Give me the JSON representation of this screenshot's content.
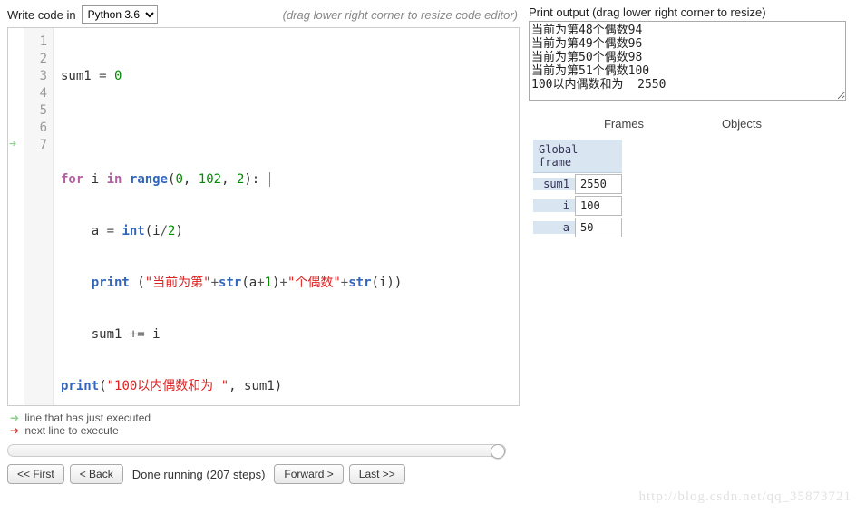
{
  "header": {
    "write_label": "Write code in",
    "language": "Python 3.6",
    "hint": "(drag lower right corner to resize code editor)"
  },
  "editor": {
    "lines": [
      "1",
      "2",
      "3",
      "4",
      "5",
      "6",
      "7"
    ],
    "exec_arrow_line": 7
  },
  "code_tokens": {
    "l1": {
      "a": "sum1 ",
      "b": "= ",
      "c": "0"
    },
    "l3": {
      "a": "for",
      "b": " i ",
      "c": "in",
      "d": " ",
      "e": "range",
      "f": "(",
      "g": "0",
      "h": ", ",
      "i": "102",
      "j": ", ",
      "k": "2",
      "l": "): "
    },
    "l4": {
      "a": "    a ",
      "b": "= ",
      "c": "int",
      "d": "(i",
      "e": "/",
      "f": "2",
      "g": ")"
    },
    "l5": {
      "a": "    ",
      "b": "print",
      "c": " (",
      "d": "\"当前为第\"",
      "e": "+",
      "f": "str",
      "g": "(a",
      "h": "+",
      "i": "1",
      "j": ")",
      "k": "+",
      "l": "\"个偶数\"",
      "m": "+",
      "n": "str",
      "o": "(i))"
    },
    "l6": {
      "a": "    sum1 ",
      "b": "+=",
      "c": " i"
    },
    "l7": {
      "a": "print",
      "b": "(",
      "c": "\"100以内偶数和为 \"",
      "d": ", sum1)"
    }
  },
  "legend": {
    "executed": "line that has just executed",
    "next": "next line to execute",
    "arrow_executed_color": "#8bd18b",
    "arrow_next_color": "#cc3b3b"
  },
  "controls": {
    "first": "<< First",
    "back": "< Back",
    "status": "Done running (207 steps)",
    "forward": "Forward >",
    "last": "Last >>"
  },
  "output": {
    "label": "Print output (drag lower right corner to resize)",
    "text": "当前为第48个偶数94\n当前为第49个偶数96\n当前为第50个偶数98\n当前为第51个偶数100\n100以内偶数和为  2550"
  },
  "viz": {
    "frames_label": "Frames",
    "objects_label": "Objects",
    "frame_title": "Global frame",
    "vars": [
      {
        "name": "sum1",
        "value": "2550"
      },
      {
        "name": "i",
        "value": "100"
      },
      {
        "name": "a",
        "value": "50"
      }
    ]
  },
  "watermark": "http://blog.csdn.net/qq_35873721"
}
